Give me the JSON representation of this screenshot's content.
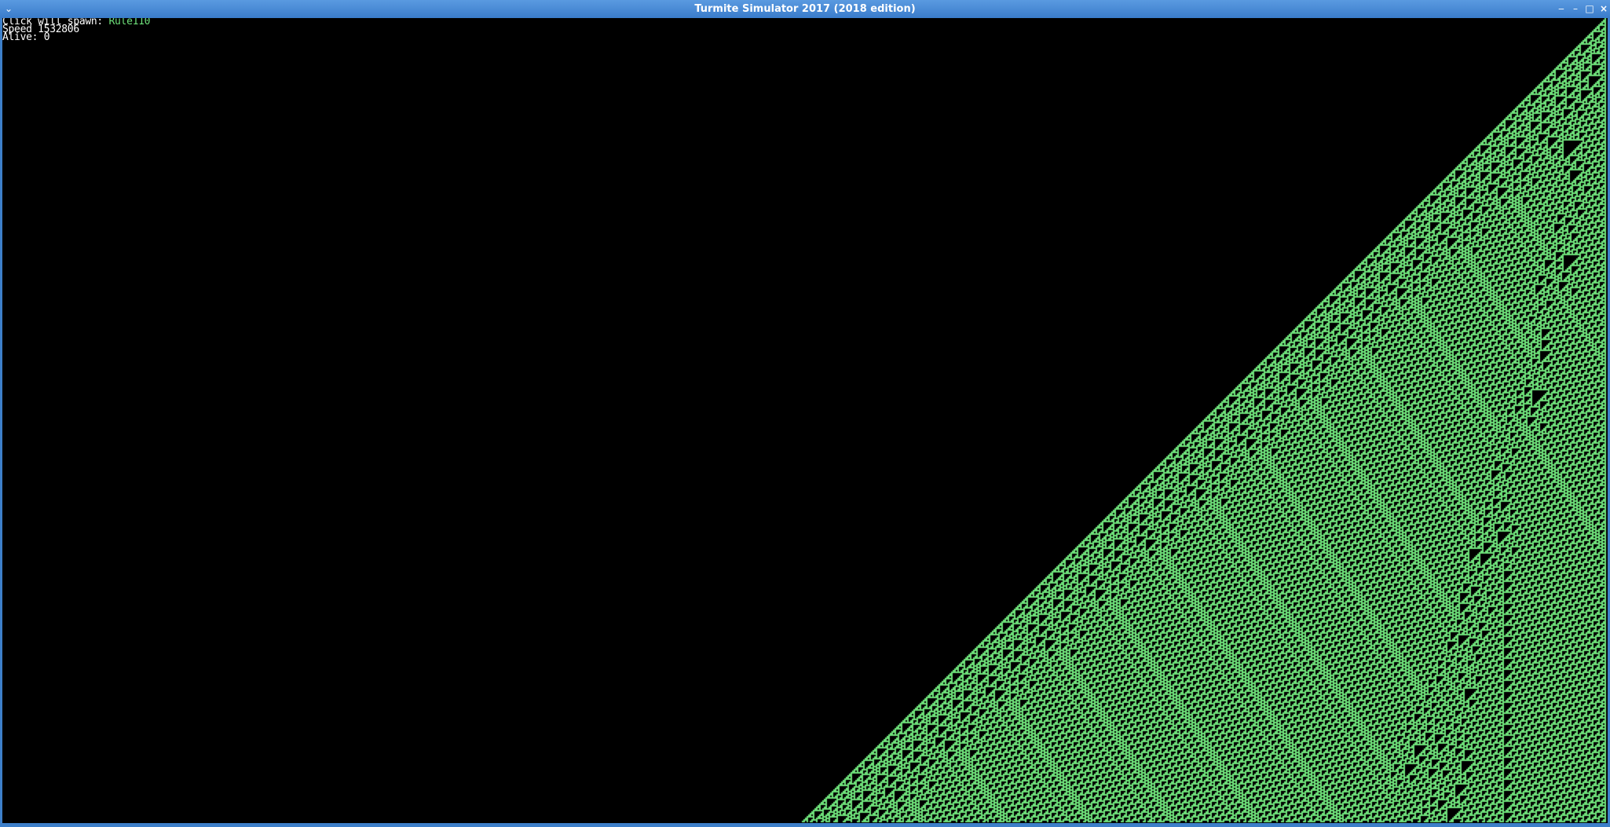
{
  "window": {
    "title": "Turmite Simulator 2017 (2018 edition)",
    "menu_icon": "chevron-down-icon",
    "controls": {
      "shade": "‒",
      "minimize": "–",
      "maximize": "□",
      "close": "×"
    }
  },
  "hud": {
    "spawn_label": "Click will spawn: ",
    "spawn_value": "Rule110",
    "speed_label": "Speed ",
    "speed_value": "1532806",
    "alive_label": "Alive: ",
    "alive_value": "0"
  },
  "colors": {
    "titlebar": "#3d7fc9",
    "background": "#000000",
    "cell_on": "#6ee07a",
    "cell_off": "#000000",
    "hud_text": "#ffffff",
    "hud_accent": "#6ee07a"
  },
  "automaton": {
    "rule": 110
  }
}
